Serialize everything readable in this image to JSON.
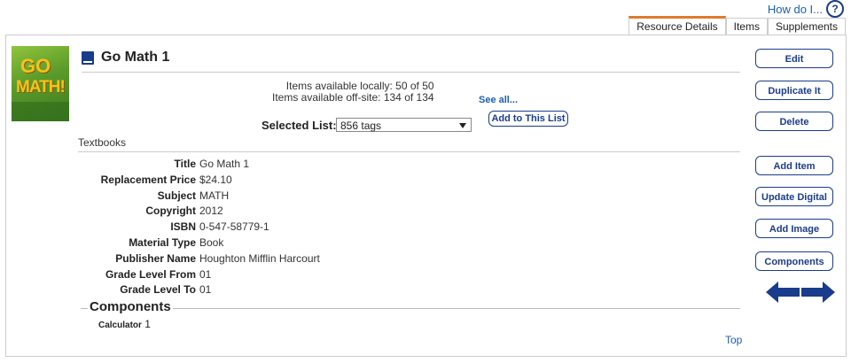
{
  "help": {
    "label": "How do I...",
    "icon": "help-icon"
  },
  "tabs": [
    {
      "label": "Resource Details",
      "active": true
    },
    {
      "label": "Items",
      "active": false
    },
    {
      "label": "Supplements",
      "active": false
    }
  ],
  "resource": {
    "title": "Go Math 1",
    "cover_line1": "GO",
    "cover_line2": "MATH!",
    "available_locally": "Items available locally: 50 of 50",
    "available_offsite": "Items available off-site: 134 of 134",
    "see_all": "See all...",
    "selected_list_label": "Selected List:",
    "selected_list_value": "856 tags",
    "add_to_list": "Add to This List",
    "category": "Textbooks"
  },
  "details": [
    {
      "label": "Title",
      "value": "Go Math 1"
    },
    {
      "label": "Replacement Price",
      "value": "$24.10"
    },
    {
      "label": "Subject",
      "value": "MATH"
    },
    {
      "label": "Copyright",
      "value": "2012"
    },
    {
      "label": "ISBN",
      "value": "0-547-58779-1"
    },
    {
      "label": "Material Type",
      "value": "Book"
    },
    {
      "label": "Publisher Name",
      "value": "Houghton Mifflin Harcourt"
    },
    {
      "label": "Grade Level From",
      "value": "01"
    },
    {
      "label": "Grade Level To",
      "value": "01"
    }
  ],
  "components": {
    "heading": "Components",
    "items": [
      {
        "label": "Calculator",
        "value": "1"
      }
    ],
    "top_link": "Top"
  },
  "actions": {
    "edit": "Edit",
    "duplicate": "Duplicate It",
    "delete": "Delete",
    "add_item": "Add Item",
    "update_digital": "Update Digital",
    "add_image": "Add Image",
    "components": "Components"
  },
  "colors": {
    "accent": "#1a3c8c",
    "link": "#1a5fb4",
    "tab_active": "#e07b2a"
  }
}
